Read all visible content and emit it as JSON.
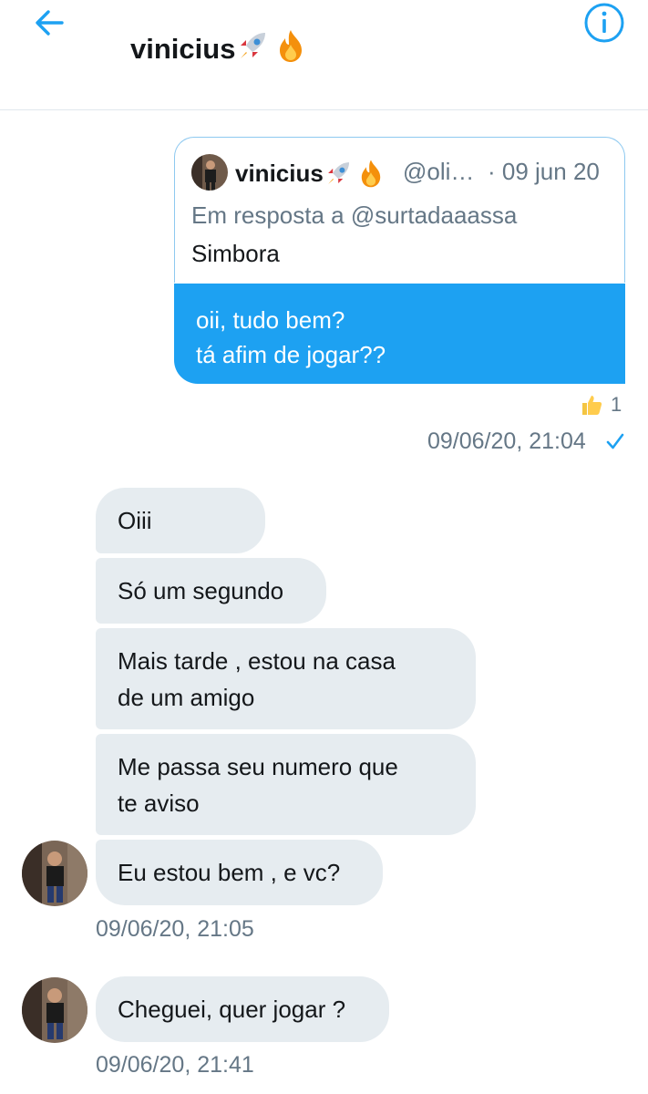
{
  "header": {
    "title": "vinicius",
    "back_icon": "arrow-left-icon",
    "info_icon": "info-circle-icon",
    "accent_color": "#1da1f2"
  },
  "quoted_tweet": {
    "name": "vinicius",
    "handle": "@oli…",
    "date": "· 09 jun 20",
    "reply_to": "Em resposta a @surtadaaassa",
    "text": "Simbora"
  },
  "sent_message": {
    "lines": [
      "oii, tudo bem?",
      "tá afim de jogar??"
    ],
    "reaction_icon": "thumbs-up-icon",
    "reaction_count": "1",
    "timestamp": "09/06/20, 21:04",
    "status_icon": "check-icon"
  },
  "received_messages": [
    {
      "lines": [
        "Oiii"
      ]
    },
    {
      "lines": [
        "Só um segundo"
      ]
    },
    {
      "lines": [
        "Mais tarde , estou na casa",
        "de um amigo"
      ]
    },
    {
      "lines": [
        "Me passa seu numero que",
        "te aviso"
      ]
    },
    {
      "lines": [
        "Eu estou bem , e vc?"
      ]
    },
    {
      "lines": [
        "Cheguei, quer jogar ?"
      ]
    }
  ],
  "received_timestamps": [
    "09/06/20, 21:05",
    "09/06/20, 21:41"
  ]
}
